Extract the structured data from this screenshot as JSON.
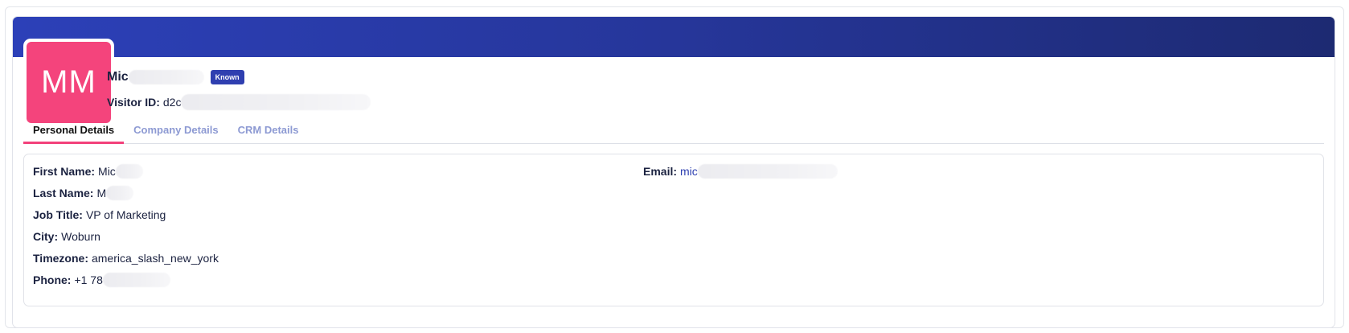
{
  "profile": {
    "initials": "MM",
    "name_visible": "Mic",
    "status_badge": "Known",
    "visitor_id_label": "Visitor ID:",
    "visitor_id_visible": "d2c"
  },
  "tabs": [
    {
      "label": "Personal Details",
      "active": true
    },
    {
      "label": "Company Details",
      "active": false
    },
    {
      "label": "CRM Details",
      "active": false
    }
  ],
  "personal": {
    "first_name": {
      "label": "First Name:",
      "value": "Mic"
    },
    "last_name": {
      "label": "Last Name:",
      "value": "M"
    },
    "job_title": {
      "label": "Job Title:",
      "value": "VP of Marketing"
    },
    "city": {
      "label": "City:",
      "value": "Woburn"
    },
    "timezone": {
      "label": "Timezone:",
      "value": "america_slash_new_york"
    },
    "phone": {
      "label": "Phone:",
      "value": "+1 78"
    },
    "email": {
      "label": "Email:",
      "value": "mic"
    }
  },
  "colors": {
    "banner_start": "#2c40b8",
    "banner_end": "#1d2a72",
    "avatar_bg": "#f4447c",
    "badge_bg": "#2f3fb0",
    "active_tab_underline": "#f2417b",
    "inactive_tab_text": "#8d9ad3",
    "email_link": "#2d3fb0"
  }
}
